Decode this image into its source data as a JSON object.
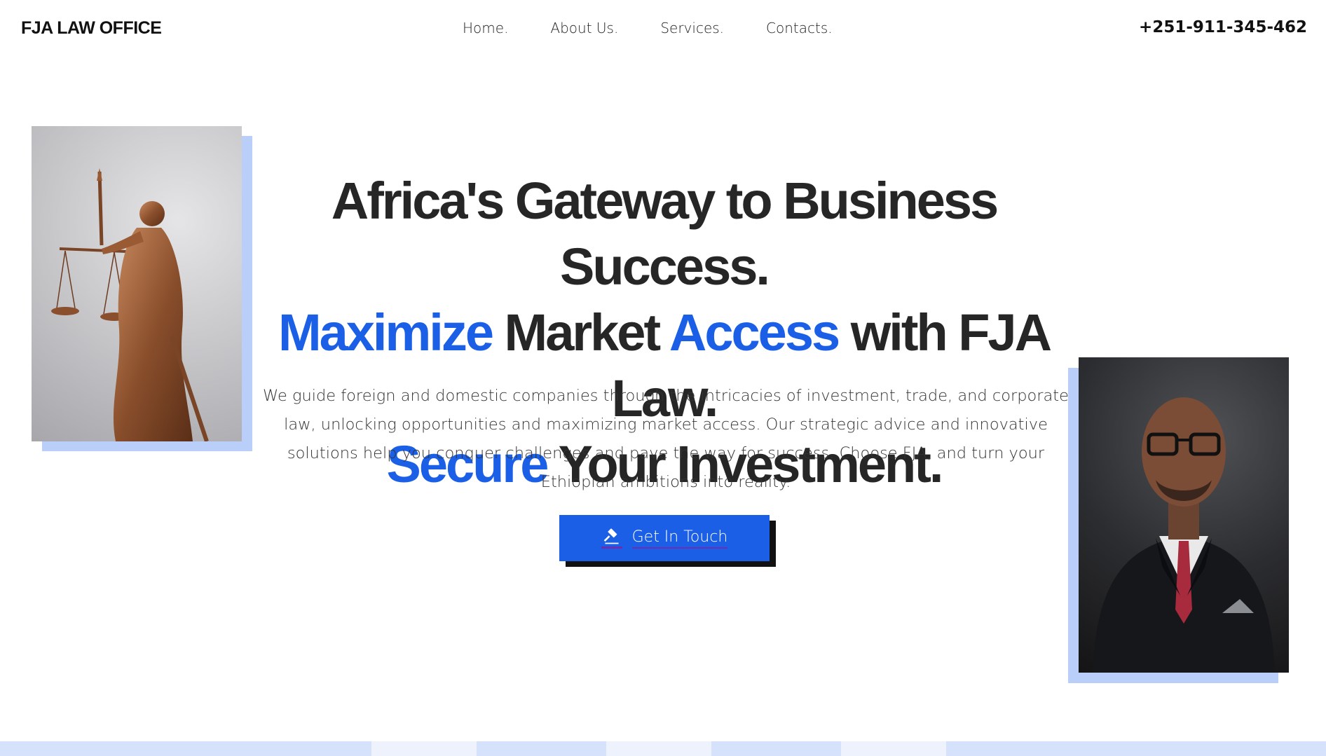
{
  "header": {
    "logo_text": "FJA LAW OFFICE",
    "nav": [
      {
        "label": "Home."
      },
      {
        "label": "About Us."
      },
      {
        "label": "Services."
      },
      {
        "label": "Contacts."
      }
    ],
    "phone": "+251-911-345-462"
  },
  "hero": {
    "line1": "Africa's Gateway to Business Success.",
    "line2": {
      "w1": "Maximize",
      "w2": " Market ",
      "w3": "Access",
      "w4": " with FJA Law."
    },
    "line3": {
      "w1": "Secure",
      "w2": " Your Investment."
    },
    "description": "We guide foreign and domestic companies through the intricacies of investment, trade, and corporate law, unlocking opportunities and maximizing market access. Our strategic advice and innovative solutions help you conquer challenges and pave the way for success. Choose FJA, and turn your Ethiopian ambitions into reality.",
    "cta_label": "Get In Touch",
    "cta_icon": "gavel-icon"
  },
  "images": {
    "left": "lady-justice-statue",
    "right": "attorney-portrait"
  },
  "colors": {
    "accent": "#1a5fe6",
    "shadow": "#b9cef8",
    "text": "#262626"
  }
}
